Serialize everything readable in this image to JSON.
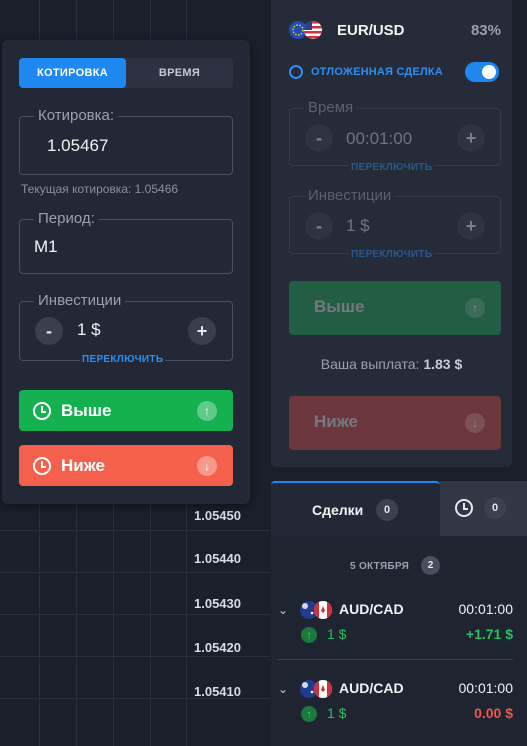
{
  "chart": {
    "price_ticks": [
      "1.05450",
      "1.05440",
      "1.05430",
      "1.05420",
      "1.05410"
    ]
  },
  "left_panel": {
    "tabs": [
      "КОТИРОВКА",
      "ВРЕМЯ"
    ],
    "quote_legend": "Котировка:",
    "quote_value": "1.05467",
    "current_quote_hint": "Текущая котировка: 1.05466",
    "period_legend": "Период:",
    "period_value": "M1",
    "investment_legend": "Инвестиции",
    "investment_value": "1 $",
    "minus": "-",
    "plus": "+",
    "switch_label": "ПЕРЕКЛЮЧИТЬ",
    "higher_label": "Выше",
    "lower_label": "Ниже"
  },
  "right_panel": {
    "pair": "EUR/USD",
    "payout_percent": "83%",
    "pending_label": "ОТЛОЖЕННАЯ СДЕЛКА",
    "pending_enabled": true,
    "time_legend": "Время",
    "time_value": "00:01:00",
    "investment_legend": "Инвестиции",
    "investment_value": "1 $",
    "minus": "-",
    "plus": "+",
    "switch_label": "ПЕРЕКЛЮЧИТЬ",
    "higher_label": "Выше",
    "lower_label": "Ниже",
    "payout_label": "Ваша выплата:",
    "payout_value": "1.83 $"
  },
  "deals_panel": {
    "tab_deals": "Сделки",
    "tab_deals_count": "0",
    "tab_history_count": "0",
    "date_label": "5 ОКТЯБРЯ",
    "date_count": "2",
    "deals": [
      {
        "pair": "AUD/CAD",
        "time": "00:01:00",
        "amount": "1 $",
        "profit": "+1.71 $",
        "profit_color": "#27c15e"
      },
      {
        "pair": "AUD/CAD",
        "time": "00:01:00",
        "amount": "1 $",
        "profit": "0.00 $",
        "profit_color": "#f0554a"
      }
    ]
  },
  "colors": {
    "accent": "#1e88f0",
    "green": "#1eb45a",
    "red": "#f5604c"
  }
}
